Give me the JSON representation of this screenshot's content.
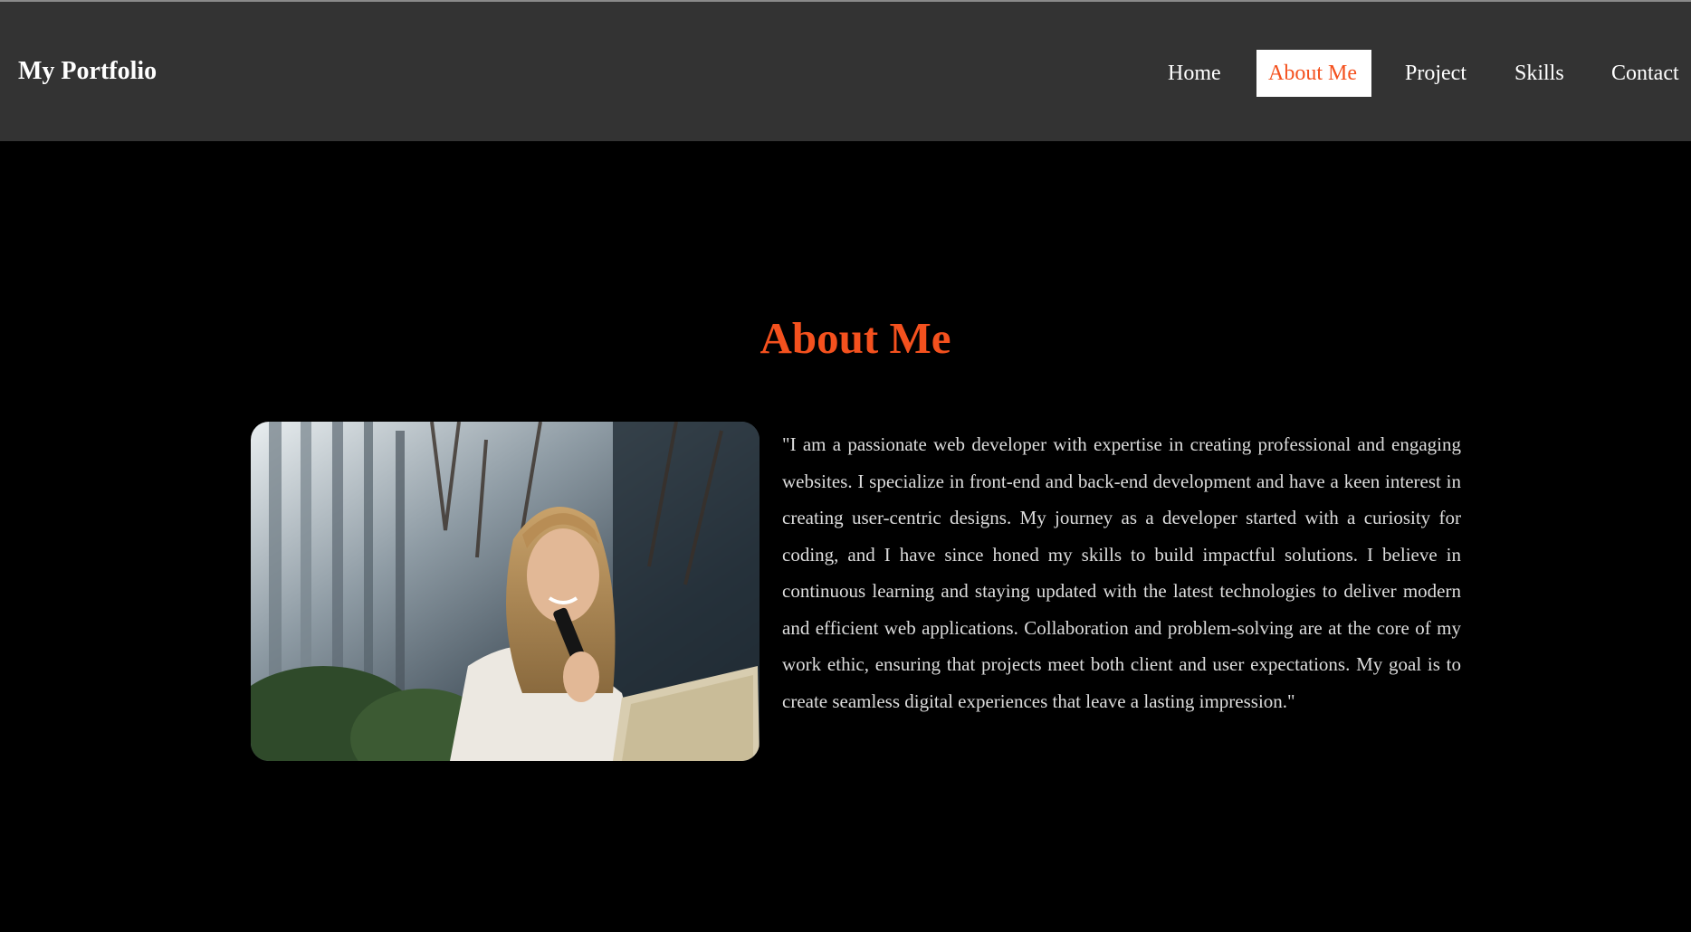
{
  "header": {
    "brand": "My Portfolio",
    "nav": [
      {
        "label": "Home",
        "active": false
      },
      {
        "label": "About Me",
        "active": true
      },
      {
        "label": "Project",
        "active": false
      },
      {
        "label": "Skills",
        "active": false
      },
      {
        "label": "Contact",
        "active": false
      }
    ]
  },
  "about": {
    "title": "About Me",
    "bio": "\"I am a passionate web developer with expertise in creating professional and engaging websites. I specialize in front-end and back-end development and have a keen interest in creating user-centric designs. My journey as a developer started with a curiosity for coding, and I have since honed my skills to build impactful solutions. I believe in continuous learning and staying updated with the latest technologies to deliver modern and efficient web applications. Collaboration and problem-solving are at the core of my work ethic, ensuring that projects meet both client and user expectations. My goal is to create seamless digital experiences that leave a lasting impression.\""
  },
  "colors": {
    "accent": "#f4511e",
    "navbar": "#333333",
    "background": "#000000",
    "text": "#dcdcdc"
  }
}
